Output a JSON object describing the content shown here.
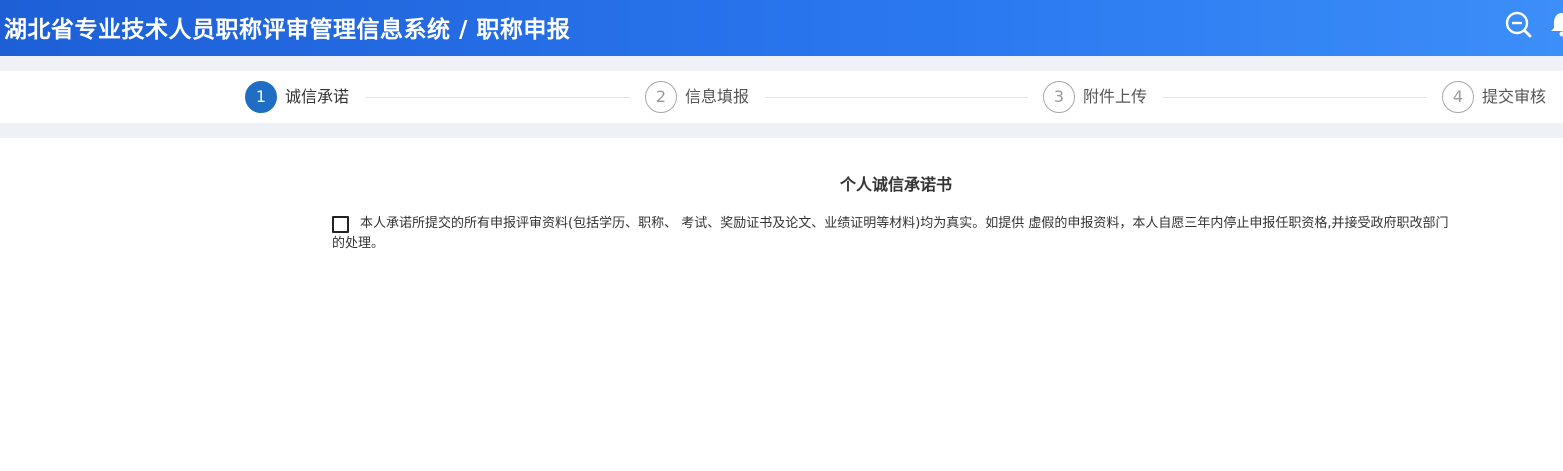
{
  "header": {
    "title": "湖北省专业技术人员职称评审管理信息系统 / 职称申报",
    "zoom_icon": "zoom-out-magnifier-icon",
    "bell_icon": "bell-icon",
    "gradient_start": "#1e5fd6",
    "gradient_end": "#3c8ef8"
  },
  "steps": [
    {
      "number": "1",
      "label": "诚信承诺",
      "active": true
    },
    {
      "number": "2",
      "label": "信息填报",
      "active": false
    },
    {
      "number": "3",
      "label": "附件上传",
      "active": false
    },
    {
      "number": "4",
      "label": "提交审核",
      "active": false
    }
  ],
  "accent_color": "#1f6ec4",
  "document": {
    "title": "个人诚信承诺书",
    "pledge_checked": false,
    "pledge_text": "本人承诺所提交的所有申报评审资料(包括学历、职称、 考试、奖励证书及论文、业绩证明等材料)均为真实。如提供 虚假的申报资料，本人自愿三年内停止申报任职资格,并接受政府职改部门的处理。"
  }
}
